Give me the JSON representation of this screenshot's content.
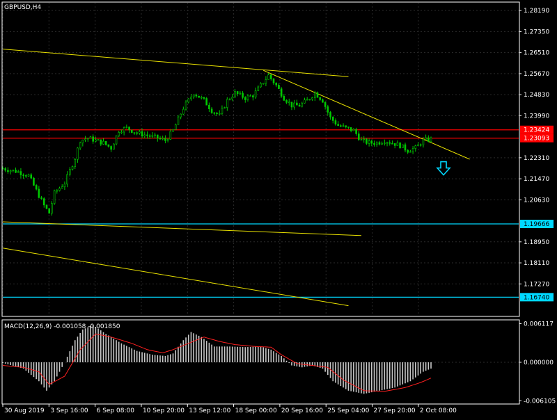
{
  "window": {
    "symbol_label": "GBPUSD,H4"
  },
  "colors": {
    "background": "#000000",
    "grid": "#2b2b2b",
    "axis": "#ffffff",
    "candle": "#00c800",
    "trendline": "#e8e000",
    "resistance": "#ff0000",
    "support": "#00d8ff",
    "macd_hist": "#c8c8c8",
    "macd_signal": "#ff2020",
    "arrow": "#00d8ff"
  },
  "chart_data": [
    {
      "type": "candlestick",
      "symbol": "GBPUSD",
      "timeframe": "H4",
      "ylim": [
        1.16,
        1.285
      ],
      "y_ticks": [
        "1.28190",
        "1.27350",
        "1.26510",
        "1.25670",
        "1.24830",
        "1.23990",
        "1.22310",
        "1.21470",
        "1.20630",
        "1.18950",
        "1.18110",
        "1.17270"
      ],
      "x_ticks": [
        "30 Aug 2019",
        "3 Sep 16:00",
        "6 Sep 08:00",
        "10 Sep 20:00",
        "13 Sep 12:00",
        "18 Sep 00:00",
        "20 Sep 16:00",
        "25 Sep 04:00",
        "27 Sep 20:00",
        "2 Oct 08:00"
      ],
      "close_path": [
        [
          0,
          1.2188
        ],
        [
          6,
          1.2175
        ],
        [
          10,
          1.216
        ],
        [
          14,
          1.208
        ],
        [
          16,
          1.204
        ],
        [
          18,
          1.201
        ],
        [
          20,
          1.209
        ],
        [
          24,
          1.213
        ],
        [
          28,
          1.223
        ],
        [
          30,
          1.23
        ],
        [
          33,
          1.231
        ],
        [
          36,
          1.23
        ],
        [
          39,
          1.229
        ],
        [
          42,
          1.227
        ],
        [
          45,
          1.234
        ],
        [
          48,
          1.235
        ],
        [
          52,
          1.233
        ],
        [
          56,
          1.232
        ],
        [
          60,
          1.231
        ],
        [
          63,
          1.23
        ],
        [
          66,
          1.234
        ],
        [
          70,
          1.243
        ],
        [
          74,
          1.249
        ],
        [
          78,
          1.246
        ],
        [
          81,
          1.242
        ],
        [
          84,
          1.24
        ],
        [
          87,
          1.246
        ],
        [
          90,
          1.249
        ],
        [
          94,
          1.247
        ],
        [
          97,
          1.248
        ],
        [
          100,
          1.252
        ],
        [
          103,
          1.256
        ],
        [
          106,
          1.252
        ],
        [
          109,
          1.247
        ],
        [
          112,
          1.244
        ],
        [
          115,
          1.244
        ],
        [
          118,
          1.246
        ],
        [
          121,
          1.249
        ],
        [
          124,
          1.246
        ],
        [
          127,
          1.239
        ],
        [
          130,
          1.236
        ],
        [
          133,
          1.235
        ],
        [
          136,
          1.234
        ],
        [
          139,
          1.23
        ],
        [
          142,
          1.229
        ],
        [
          145,
          1.229
        ],
        [
          148,
          1.23
        ],
        [
          151,
          1.229
        ],
        [
          154,
          1.228
        ],
        [
          157,
          1.226
        ],
        [
          160,
          1.227
        ],
        [
          163,
          1.23
        ],
        [
          166,
          1.2305
        ]
      ],
      "last_index": 166,
      "x_max": 200,
      "levels": [
        {
          "name": "resistance-1",
          "price": 1.23424,
          "label": "1.23424",
          "kind": "resistance"
        },
        {
          "name": "resistance-2",
          "price": 1.23093,
          "label": "1.23093",
          "kind": "resistance"
        },
        {
          "name": "support-1",
          "price": 1.19666,
          "label": "1.19666",
          "kind": "support"
        },
        {
          "name": "support-2",
          "price": 1.1674,
          "label": "1.16740",
          "kind": "support"
        }
      ],
      "trendlines": [
        {
          "name": "upper-channel-line",
          "from": [
            0,
            1.2665
          ],
          "to": [
            134,
            1.2555
          ]
        },
        {
          "name": "descending-trendline",
          "from": [
            101,
            1.258
          ],
          "to": [
            181,
            1.2225
          ]
        },
        {
          "name": "lower-channel-line",
          "from": [
            0,
            1.1975
          ],
          "to": [
            139,
            1.192
          ]
        },
        {
          "name": "lower-parallel-line",
          "from": [
            0,
            1.187
          ],
          "to": [
            134,
            1.164
          ]
        }
      ],
      "signal_arrow": {
        "x": 166,
        "price": 1.219,
        "direction": "down"
      }
    },
    {
      "type": "macd",
      "indicator_label": "MACD(12,26,9) -0.001058 -0.001850",
      "ylim": [
        -0.0065,
        0.0065
      ],
      "y_ticks": [
        "0.006117",
        "0.000000",
        "-0.006105"
      ],
      "zero_label": "0.000000",
      "histogram_path": [
        [
          0,
          -0.0001
        ],
        [
          8,
          -0.001
        ],
        [
          14,
          -0.003
        ],
        [
          17,
          -0.0045
        ],
        [
          20,
          -0.003
        ],
        [
          24,
          0.0
        ],
        [
          28,
          0.0035
        ],
        [
          31,
          0.0052
        ],
        [
          35,
          0.0059
        ],
        [
          40,
          0.0045
        ],
        [
          46,
          0.003
        ],
        [
          52,
          0.0018
        ],
        [
          58,
          0.0012
        ],
        [
          63,
          0.001
        ],
        [
          66,
          0.0014
        ],
        [
          70,
          0.0035
        ],
        [
          73,
          0.0048
        ],
        [
          77,
          0.004
        ],
        [
          82,
          0.0025
        ],
        [
          88,
          0.0025
        ],
        [
          94,
          0.0024
        ],
        [
          100,
          0.0025
        ],
        [
          104,
          0.002
        ],
        [
          108,
          0.001
        ],
        [
          112,
          -0.0005
        ],
        [
          116,
          -0.0008
        ],
        [
          120,
          -0.0005
        ],
        [
          124,
          -0.001
        ],
        [
          128,
          -0.003
        ],
        [
          134,
          -0.0045
        ],
        [
          140,
          -0.005
        ],
        [
          146,
          -0.0045
        ],
        [
          152,
          -0.004
        ],
        [
          158,
          -0.003
        ],
        [
          163,
          -0.0015
        ],
        [
          166,
          -0.001
        ]
      ],
      "signal_path": [
        [
          0,
          -0.0005
        ],
        [
          8,
          -0.0008
        ],
        [
          14,
          -0.0015
        ],
        [
          18,
          -0.0035
        ],
        [
          24,
          -0.0022
        ],
        [
          30,
          0.002
        ],
        [
          36,
          0.0045
        ],
        [
          42,
          0.004
        ],
        [
          50,
          0.003
        ],
        [
          56,
          0.002
        ],
        [
          62,
          0.0015
        ],
        [
          66,
          0.002
        ],
        [
          72,
          0.003
        ],
        [
          78,
          0.004
        ],
        [
          84,
          0.0033
        ],
        [
          90,
          0.0028
        ],
        [
          98,
          0.0025
        ],
        [
          104,
          0.0024
        ],
        [
          108,
          0.0012
        ],
        [
          114,
          -0.0002
        ],
        [
          120,
          -0.0005
        ],
        [
          126,
          -0.0008
        ],
        [
          132,
          -0.0028
        ],
        [
          140,
          -0.0045
        ],
        [
          148,
          -0.0046
        ],
        [
          156,
          -0.004
        ],
        [
          162,
          -0.0032
        ],
        [
          166,
          -0.0025
        ]
      ]
    }
  ]
}
